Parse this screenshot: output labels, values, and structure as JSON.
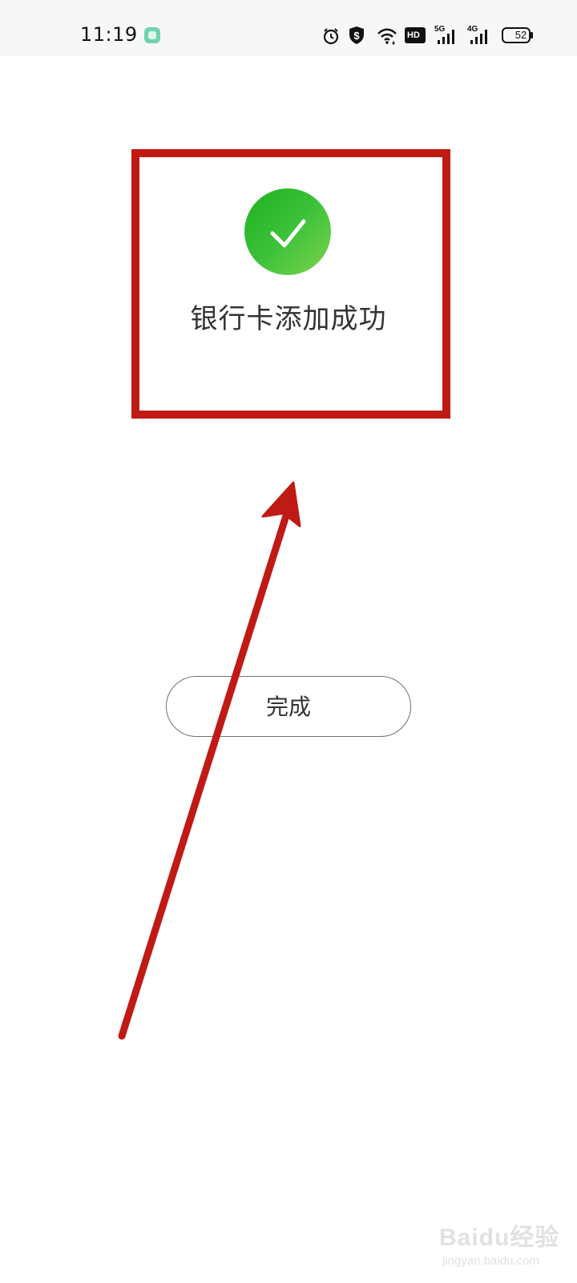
{
  "status_bar": {
    "time": "11:19",
    "network_5g": "5G",
    "network_4g": "4G",
    "hd_label": "HD",
    "battery_level": "52",
    "icons": [
      "app-icon",
      "alarm-icon",
      "shield-dollar-icon",
      "wifi-icon",
      "hd-icon",
      "signal-5g-icon",
      "signal-4g-icon",
      "battery-icon"
    ]
  },
  "main": {
    "success_icon": "check-circle-icon",
    "success_message": "银行卡添加成功",
    "done_button_label": "完成"
  },
  "annotations": {
    "highlight_color": "#c01a14",
    "arrow_color": "#c01a14"
  },
  "watermark": {
    "brand": "Baidu经验",
    "url": "jingyan.baidu.com"
  },
  "colors": {
    "success_green": "#1fb21f",
    "text": "#333333",
    "status_bar_bg": "#f7f7f7"
  }
}
